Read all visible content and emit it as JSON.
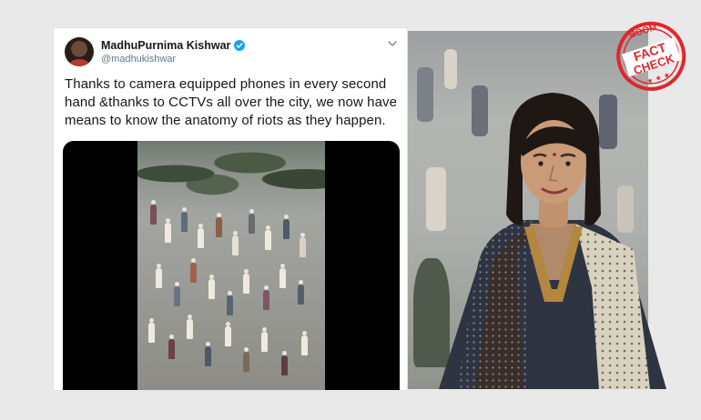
{
  "tweet": {
    "display_name": "MadhuPurnima Kishwar",
    "handle": "@madhukishwar",
    "text": "Thanks to camera equipped phones in every second hand &thanks to CCTVs all over the city, we now have means to know the anatomy of riots as they happen."
  },
  "stamp": {
    "brand": "BOOM",
    "line1": "FACT",
    "line2": "CHECK"
  },
  "colors": {
    "verified": "#1da1f2",
    "stamp_red": "#e0262c"
  },
  "icons": [
    "verified-badge-icon",
    "chevron-down-icon"
  ]
}
